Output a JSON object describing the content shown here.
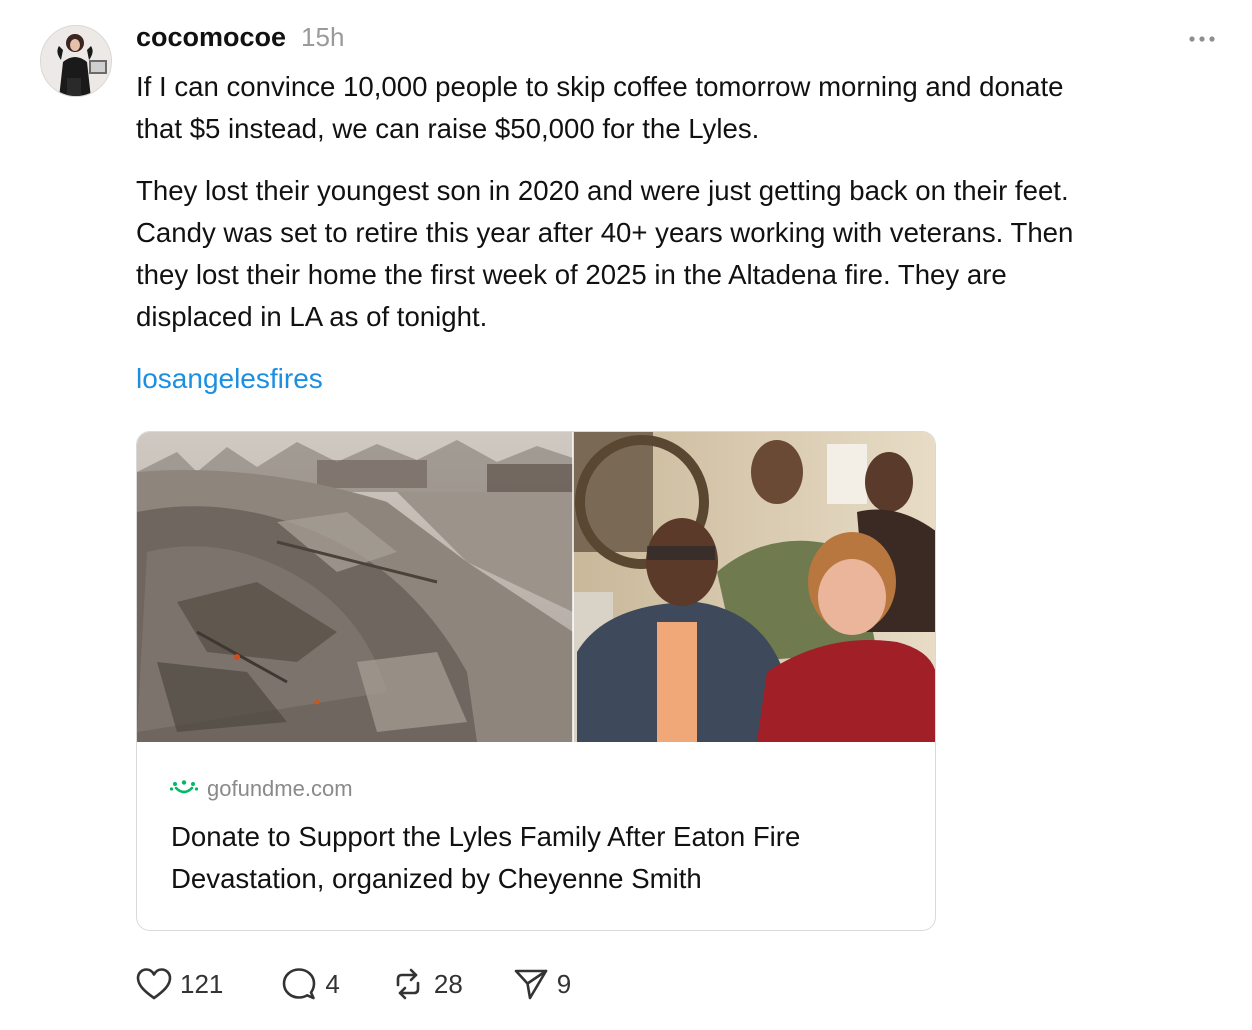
{
  "post": {
    "username": "cocomocoe",
    "timestamp": "15h",
    "paragraphs": [
      "If I can convince 10,000 people to skip coffee tomorrow morning and donate\nthat $5 instead, we can raise $50,000 for the Lyles.",
      "They lost their youngest son in 2020 and were just getting back on their feet.\nCandy was set to retire this year after 40+ years working with veterans. Then\nthey lost their home the first week of 2025 in the Altadena fire. They are\ndisplaced in LA as of tonight."
    ],
    "tag": "losangelesfires"
  },
  "link_card": {
    "domain": "gofundme.com",
    "title": "Donate to Support the Lyles Family After Eaton Fire\nDevastation, organized by Cheyenne Smith",
    "brand_color": "#00b964"
  },
  "actions": {
    "likes": "121",
    "replies": "4",
    "reposts": "28",
    "shares": "9"
  },
  "colors": {
    "text": "#111111",
    "muted": "#9a9a9a",
    "link": "#1d8fe1",
    "border": "#d9d9d9"
  },
  "icons": {
    "more": "ellipsis-icon",
    "like": "heart-icon",
    "reply": "speech-bubble-icon",
    "repost": "repost-arrows-icon",
    "share": "paper-plane-icon",
    "domain": "gofundme-logo-icon"
  }
}
